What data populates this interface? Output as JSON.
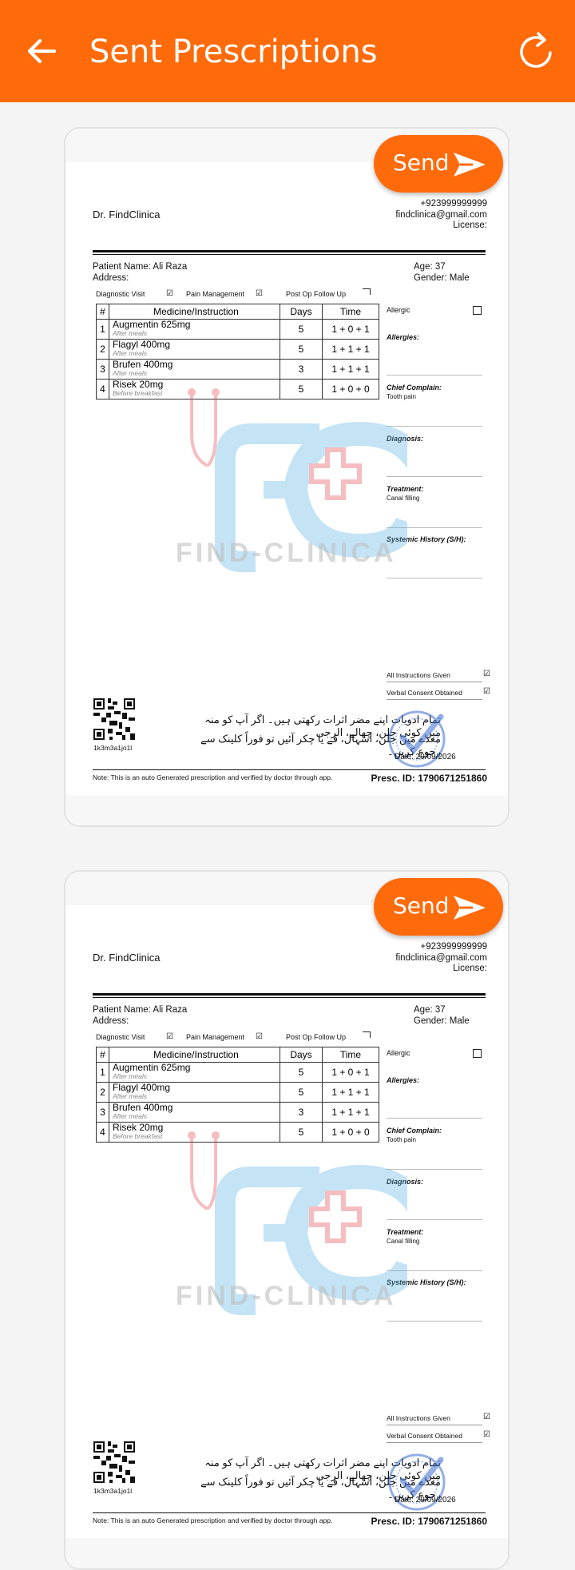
{
  "appbar": {
    "title": "Sent Prescriptions",
    "back_icon": "arrow-left-icon",
    "refresh_icon": "refresh-icon"
  },
  "send_label": "Send",
  "prescription": {
    "doctor": "Dr. FindClinica",
    "phone": "+923999999999",
    "email": "findclinica@gmail.com",
    "license": "License:",
    "patient_name": "Patient Name: Ali Raza",
    "address": "Address:",
    "age": "Age: 37",
    "gender": "Gender: Male",
    "visit_types": [
      "Diagnostic Visit",
      "Pain Management",
      "Post Op Follow Up"
    ],
    "table_headers": [
      "#",
      "Medicine/Instruction",
      "Days",
      "Time"
    ],
    "medicines": [
      {
        "no": "1",
        "name": "Augmentin 625mg",
        "note": "After meals",
        "days": "5",
        "time": "1 + 0 + 1"
      },
      {
        "no": "2",
        "name": "Flagyl 400mg",
        "note": "After meals",
        "days": "5",
        "time": "1 + 1 + 1"
      },
      {
        "no": "3",
        "name": "Brufen 400mg",
        "note": "After meals",
        "days": "3",
        "time": "1 + 1 + 1"
      },
      {
        "no": "4",
        "name": "Risek 20mg",
        "note": "Before breakfast",
        "days": "5",
        "time": "1 + 0 + 0"
      }
    ],
    "allergic": "Allergic",
    "allergies": "Allergies:",
    "chief_complain": "Chief Complain:",
    "chief_complain_value": "Tooth pain",
    "diagnosis": "Diagnosis:",
    "treatment": "Treatment:",
    "treatment_value": "Canal filling",
    "systemic_history": "Systemic History (S/H):",
    "watermark": "FIND-CLINICA",
    "all_instructions": "All Instructions Given",
    "verbal_consent": "Verbal Consent Obtained",
    "qr_code_text": "1k3m3a1jo1l",
    "urdu_line1": "تمام ادویات اپنے مضر اثرات رکھتی ہیں۔ اگر آپ کو منہ میں کوئی جلن، چھالے، الرجی",
    "urdu_line2": "معدے میں جلن، اسہال، قے یا چکر آئیں تو فوراً کلینک سے رجوع کریں۔",
    "stamp_text": "VERIFIED",
    "date": "Date: 29/09/2026",
    "note": "Note: This is an auto Generated prescription and verified by doctor through app.",
    "presc_id": "Presc. ID: 1790671251860"
  },
  "colors": {
    "brand": "#ff6a0a",
    "watermark_blue": "#5ab4e6",
    "watermark_red": "#e8454f"
  }
}
